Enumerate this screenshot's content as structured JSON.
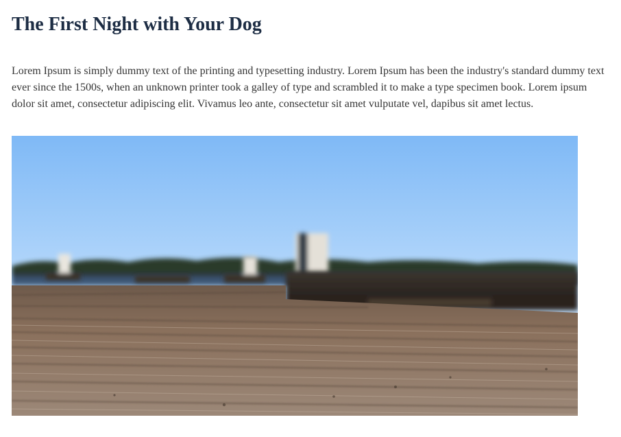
{
  "article": {
    "title": "The First Night with Your Dog",
    "body": "Lorem Ipsum is simply dummy text of the printing and typesetting industry. Lorem Ipsum has been the industry's standard dummy text ever since the 1500s, when an unknown printer took a galley of type and scrambled it to make a type specimen book. Lorem ipsum dolor sit amet, consectetur adipiscing elit. Vivamus leo ante, consectetur sit amet vulputate vel, dapibus sit amet lectus."
  },
  "colors": {
    "title": "#1d2d44",
    "text": "#333333",
    "sky_top": "#86bff7",
    "sky_bottom": "#dfeefe",
    "deck": "#8a6f5a"
  },
  "image": {
    "icon": "blurred-dock-photo"
  }
}
